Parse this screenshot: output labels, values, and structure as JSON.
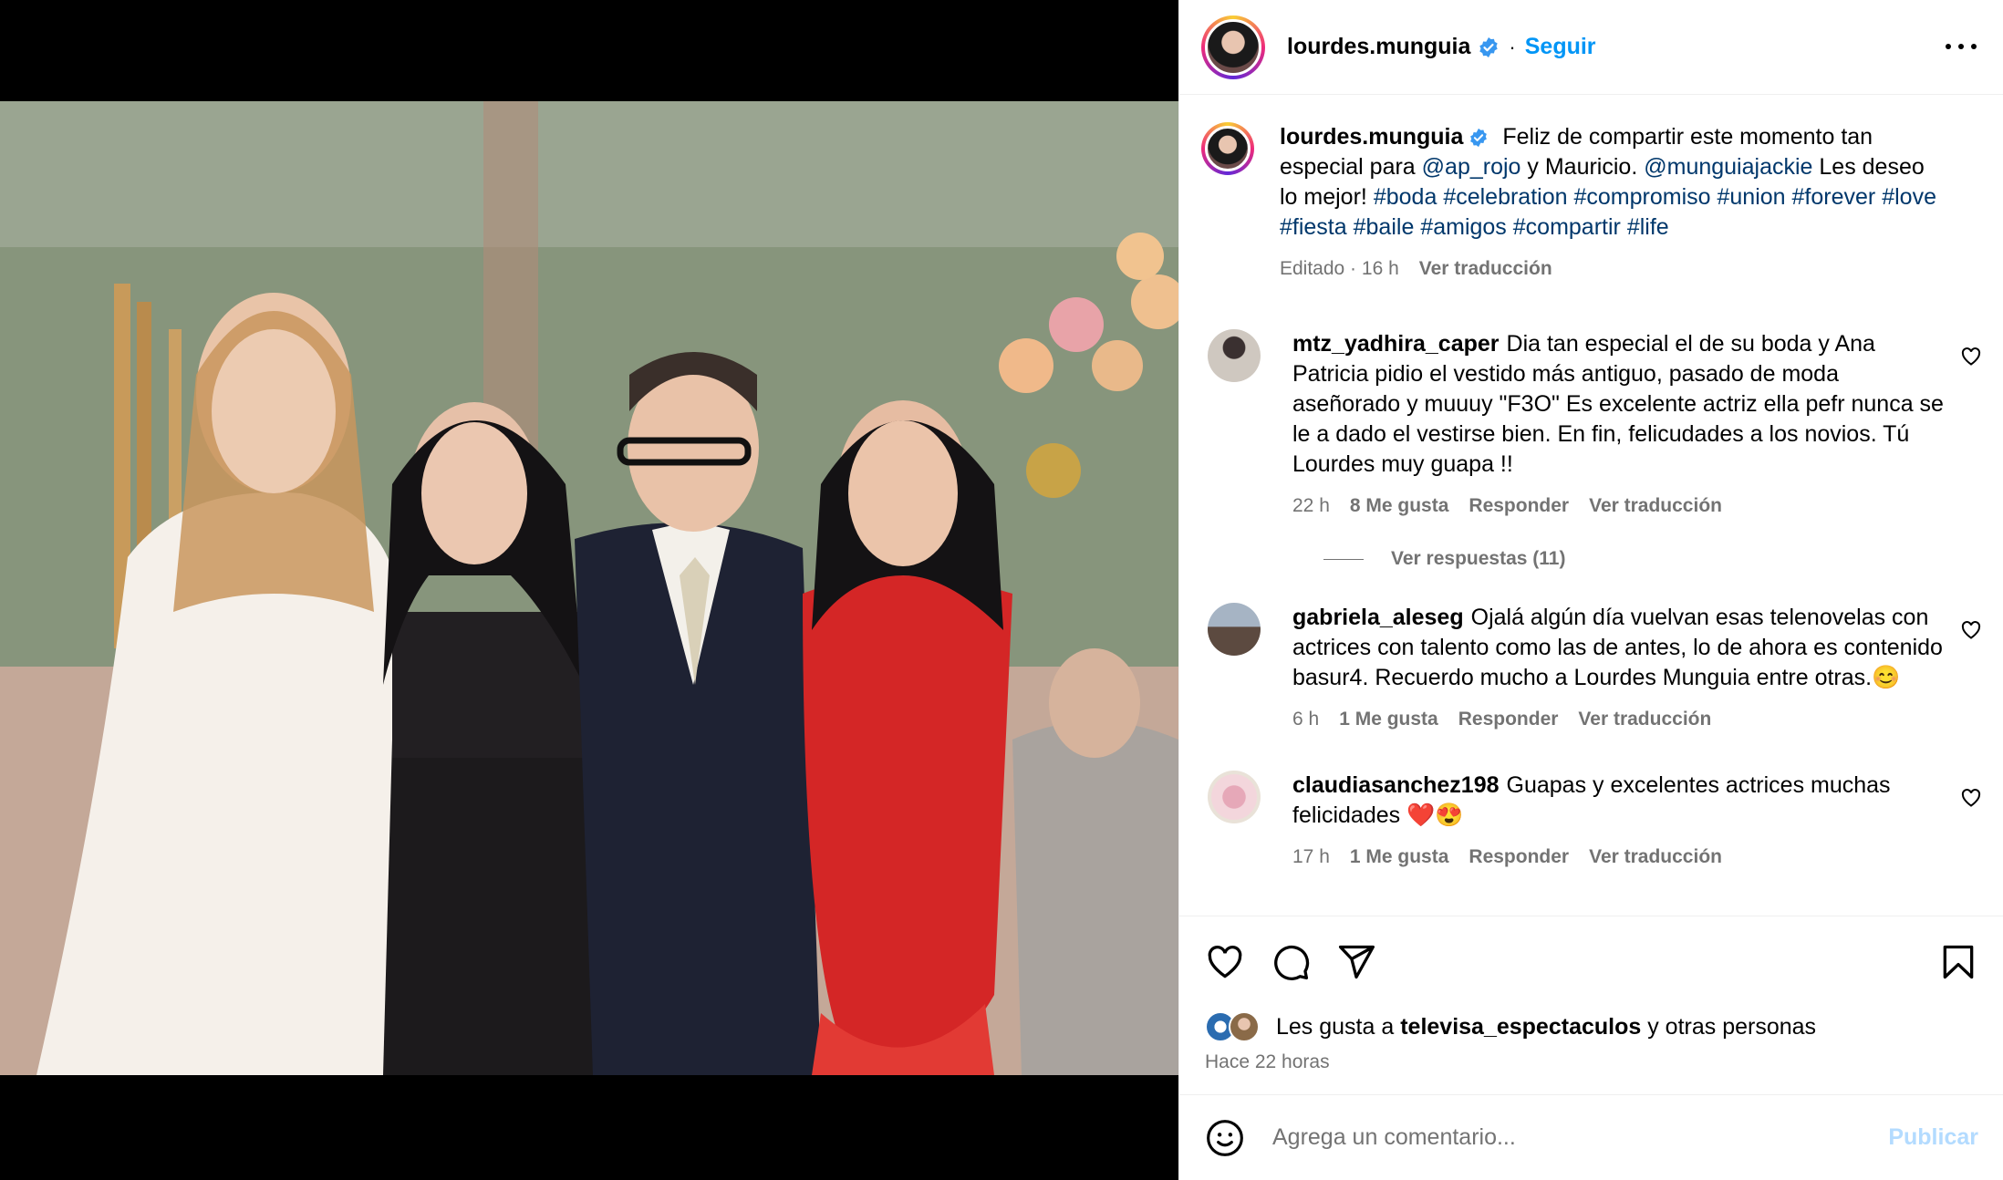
{
  "post": {
    "username": "lourdes.munguia",
    "follow_label": "Seguir",
    "separator": "·"
  },
  "caption": {
    "username": "lourdes.munguia",
    "text_1": "Feliz de compartir este momento tan especial para",
    "mention_1": "@ap_rojo",
    "text_2": "y Mauricio.",
    "mention_2": "@munguiajackie",
    "text_3": "Les deseo lo mejor!",
    "hashtags": [
      "#boda",
      "#celebration",
      "#compromiso",
      "#union",
      "#forever",
      "#love",
      "#fiesta",
      "#baile",
      "#amigos",
      "#compartir",
      "#life"
    ],
    "meta_edited": "Editado · 16 h",
    "translate": "Ver traducción"
  },
  "comments": [
    {
      "username": "mtz_yadhira_caper",
      "text": "Dia tan especial el de su boda y Ana Patricia pidio el vestido más antiguo, pasado de moda aseñorado y muuuy \"F3O\" Es excelente actriz ella pefr nunca se le a dado el vestirse bien. En fin, felicudades a los novios. Tú Lourdes muy guapa !!",
      "time": "22 h",
      "likes": "8 Me gusta",
      "reply": "Responder",
      "translate": "Ver traducción",
      "replies_label": "Ver respuestas (11)"
    },
    {
      "username": "gabriela_aleseg",
      "text": "Ojalá algún día vuelvan esas telenovelas con actrices con talento como las de antes, lo de ahora es contenido basur4. Recuerdo mucho a Lourdes Munguia entre otras.😊",
      "time": "6 h",
      "likes": "1 Me gusta",
      "reply": "Responder",
      "translate": "Ver traducción"
    },
    {
      "username": "claudiasanchez198",
      "text": "Guapas y excelentes actrices muchas felicidades ❤️😍",
      "time": "17 h",
      "likes": "1 Me gusta",
      "reply": "Responder",
      "translate": "Ver traducción"
    }
  ],
  "likes": {
    "prefix": "Les gusta a",
    "user": "televisa_espectaculos",
    "suffix": "y otras personas",
    "time_ago": "Hace 22 horas"
  },
  "add_comment": {
    "placeholder": "Agrega un comentario...",
    "publish_label": "Publicar"
  },
  "icons": {
    "verified": "verified-badge-icon",
    "like": "heart-icon",
    "comment": "comment-icon",
    "share": "paper-plane-icon",
    "save": "bookmark-icon",
    "emoji": "smiley-icon",
    "more": "more-options-icon"
  },
  "colors": {
    "link_blue": "#0095f6",
    "hashtag_blue": "#00376b",
    "meta_gray": "#737373",
    "verified_blue": "#3897f0"
  }
}
